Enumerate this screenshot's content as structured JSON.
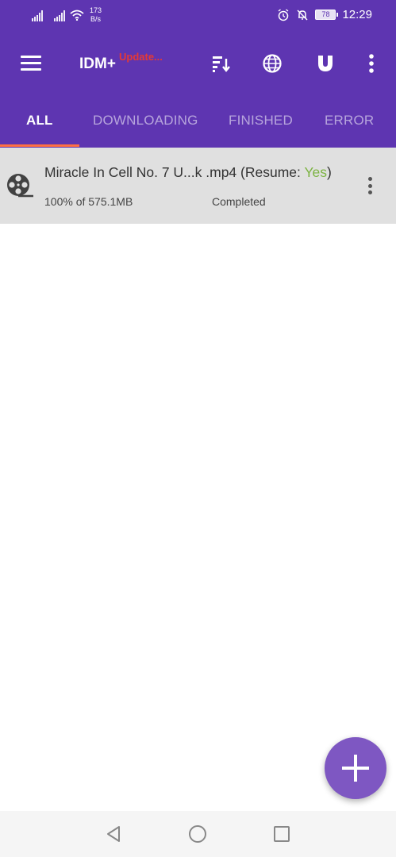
{
  "status_bar": {
    "net_speed_value": "173",
    "net_speed_unit": "B/s",
    "battery": "78",
    "time": "12:29"
  },
  "toolbar": {
    "title": "IDM+",
    "update_badge": "Update...",
    "icons": [
      "menu-icon",
      "sort-icon",
      "browser-icon",
      "magnet-icon",
      "more-vert-icon"
    ]
  },
  "tabs": [
    {
      "label": "ALL",
      "active": true
    },
    {
      "label": "DOWNLOADING",
      "active": false
    },
    {
      "label": "FINISHED",
      "active": false
    },
    {
      "label": "ERROR",
      "active": false
    }
  ],
  "downloads": [
    {
      "name": "Miracle In Cell No. 7 U...k .mp4",
      "resume_label": "(Resume: ",
      "resume_value": "Yes",
      "resume_close": ")",
      "progress": "100% of 575.1MB",
      "status": "Completed"
    }
  ],
  "colors": {
    "appbar": "#5e35b1",
    "tab_indicator": "#ff7043",
    "fab": "#7e57c2",
    "resume_yes": "#7cb342",
    "update_badge": "#e53935",
    "row_bg": "#e0e0e0"
  }
}
